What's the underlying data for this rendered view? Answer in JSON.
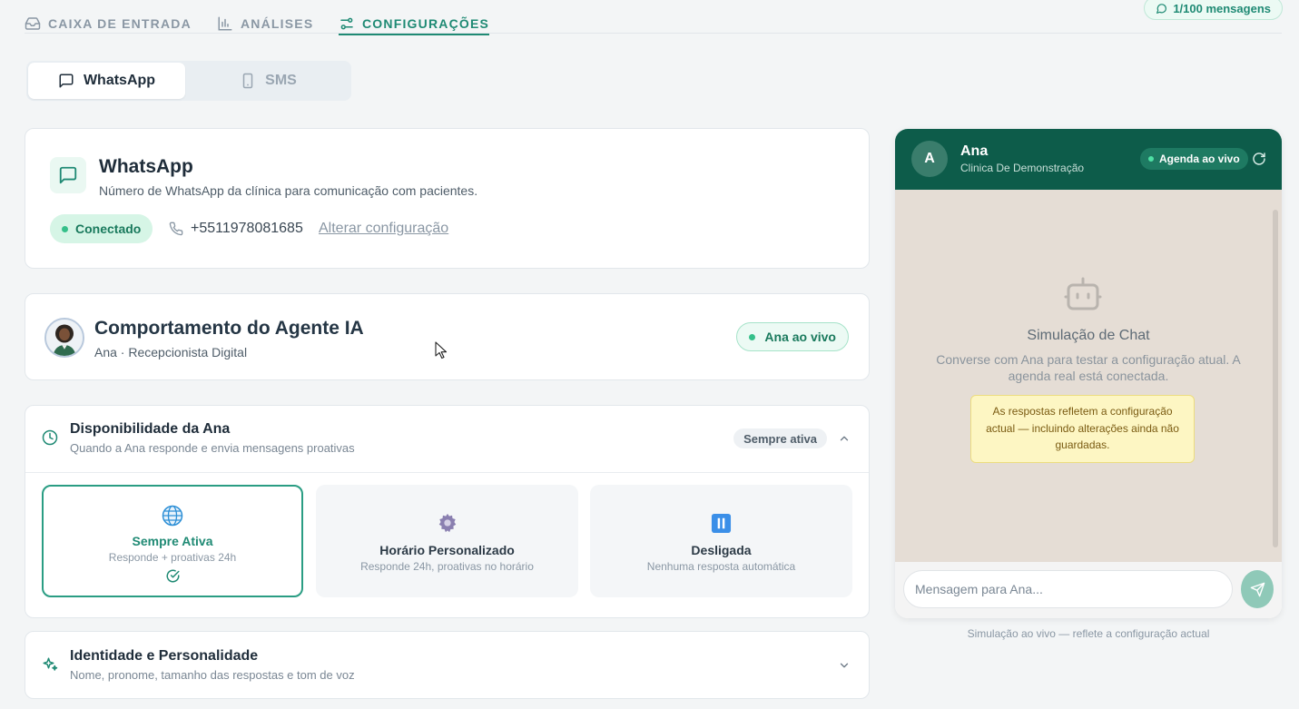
{
  "topnav": {
    "tabs": [
      {
        "label": "CAIXA DE ENTRADA",
        "icon": "inbox-icon"
      },
      {
        "label": "ANÁLISES",
        "icon": "bar-chart-icon"
      },
      {
        "label": "CONFIGURAÇÕES",
        "icon": "sliders-icon"
      }
    ],
    "active_tab": "CONFIGURAÇÕES",
    "quota": "1/100 mensagens"
  },
  "channel_tabs": [
    {
      "label": "WhatsApp",
      "icon": "message-square-icon"
    },
    {
      "label": "SMS",
      "icon": "smartphone-icon"
    }
  ],
  "whatsapp_card": {
    "title": "WhatsApp",
    "subtitle": "Número de WhatsApp da clínica para comunicação com pacientes.",
    "status": "Conectado",
    "phone": "+5511978081685",
    "change_link": "Alterar configuração"
  },
  "agent_card": {
    "title": "Comportamento do Agente IA",
    "subtitle": "Ana · Recepcionista Digital",
    "live_badge": "Ana ao vivo"
  },
  "availability": {
    "title": "Disponibilidade da Ana",
    "subtitle": "Quando a Ana responde e envia mensagens proativas",
    "badge": "Sempre ativa",
    "options": [
      {
        "title": "Sempre Ativa",
        "subtitle": "Responde + proativas 24h",
        "icon": "globe-icon",
        "selected": true
      },
      {
        "title": "Horário Personalizado",
        "subtitle": "Responde 24h, proativas no horário",
        "icon": "gear-icon",
        "selected": false
      },
      {
        "title": "Desligada",
        "subtitle": "Nenhuma resposta automática",
        "icon": "pause-icon",
        "selected": false
      }
    ]
  },
  "identity": {
    "title": "Identidade e Personalidade",
    "subtitle": "Nome, pronome, tamanho das respostas e tom de voz"
  },
  "chat": {
    "avatar_letter": "A",
    "name": "Ana",
    "clinic": "Clinica De Demonstração",
    "live_badge": "Agenda ao vivo",
    "sim_title": "Simulação de Chat",
    "sim_subtitle": "Converse com Ana para testar a configuração atual. A agenda real está conectada.",
    "note": "As respostas refletem a configuração actual — incluindo alterações ainda não guardadas.",
    "input_placeholder": "Mensagem para Ana...",
    "caption": "Simulação ao vivo — reflete a configuração actual"
  },
  "colors": {
    "accent": "#1f8a74",
    "chat_header": "#0d5c4a",
    "chat_background": "#e5ddd5",
    "note_background": "#fdf6c3"
  }
}
